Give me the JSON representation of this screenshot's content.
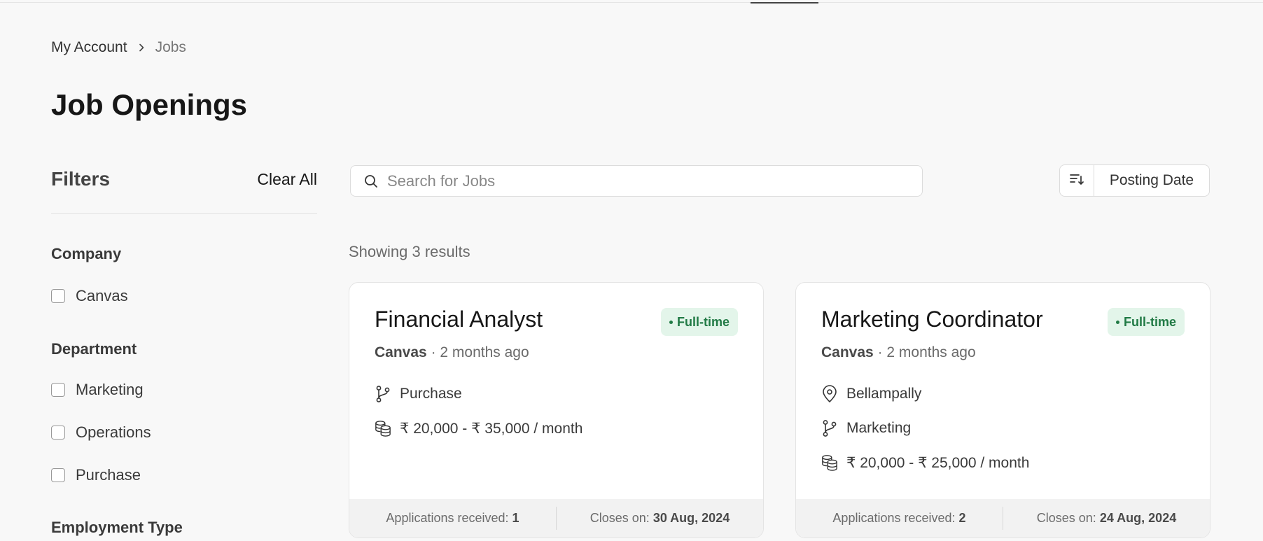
{
  "breadcrumb": {
    "items": [
      "My Account",
      "Jobs"
    ]
  },
  "page": {
    "title": "Job Openings"
  },
  "filters": {
    "title": "Filters",
    "clear_label": "Clear All",
    "groups": [
      {
        "title": "Company",
        "options": [
          "Canvas"
        ]
      },
      {
        "title": "Department",
        "options": [
          "Marketing",
          "Operations",
          "Purchase"
        ]
      },
      {
        "title": "Employment Type",
        "options": []
      }
    ]
  },
  "search": {
    "placeholder": "Search for Jobs",
    "value": ""
  },
  "sort": {
    "label": "Posting Date",
    "icon": "sort-desc-icon"
  },
  "results": {
    "count_text": "Showing 3 results"
  },
  "jobs": [
    {
      "title": "Financial Analyst",
      "type": "Full-time",
      "company": "Canvas",
      "posted": "· 2 months ago",
      "department": "Purchase",
      "salary": "₹ 20,000 - ₹ 35,000 / month",
      "applications_label": "Applications received:",
      "applications_count": "1",
      "closes_label": "Closes on:",
      "closes_date": "30 Aug, 2024"
    },
    {
      "title": "Marketing Coordinator",
      "type": "Full-time",
      "company": "Canvas",
      "posted": "· 2 months ago",
      "location": "Bellampally",
      "department": "Marketing",
      "salary": "₹ 20,000 - ₹ 25,000 / month",
      "applications_label": "Applications received:",
      "applications_count": "2",
      "closes_label": "Closes on:",
      "closes_date": "24 Aug, 2024"
    }
  ],
  "colors": {
    "badge_bg": "#e3f5ea",
    "badge_text": "#217a45",
    "page_bg": "#f8f8f8"
  }
}
